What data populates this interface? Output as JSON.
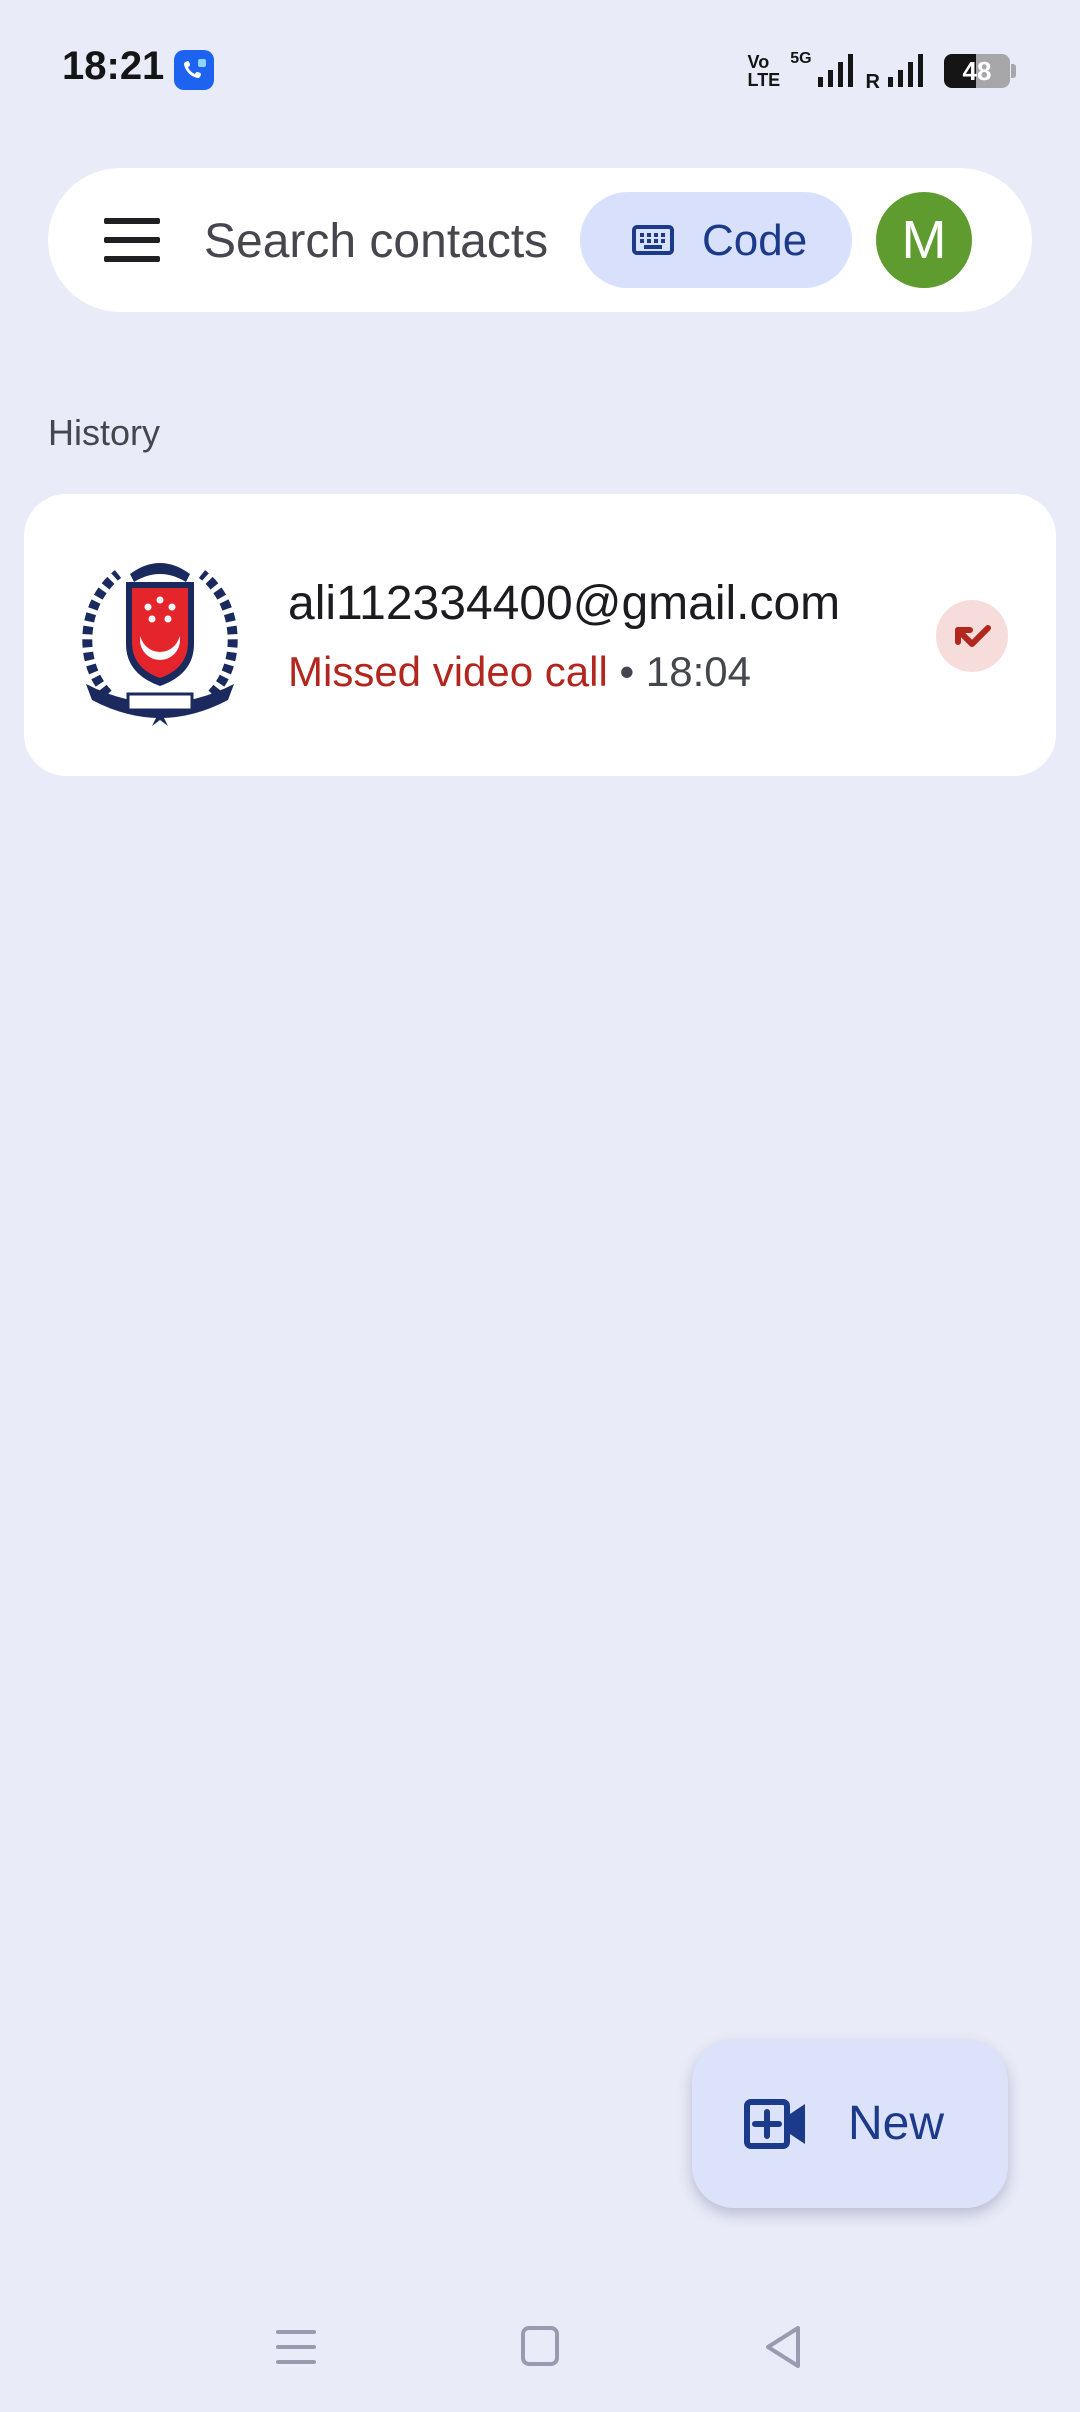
{
  "status_bar": {
    "time": "18:21",
    "app_icon": "phone-app-icon",
    "volte_line1": "Vo",
    "volte_line2": "LTE",
    "network": "5G",
    "roaming": "R",
    "battery_level": "48",
    "battery_percent": 48
  },
  "search": {
    "placeholder": "Search contacts",
    "menu_icon": "hamburger-menu-icon",
    "code_label": "Code",
    "code_icon": "keyboard-icon",
    "avatar_initial": "M",
    "avatar_color": "#5f9c2f"
  },
  "history": {
    "section_title": "History",
    "items": [
      {
        "contact": "ali112334400@gmail.com",
        "status": "Missed video call",
        "separator": " • ",
        "time": "18:04",
        "avatar_icon": "police-crest-logo",
        "status_color": "#b3261e",
        "action_icon": "missed-call-icon"
      }
    ]
  },
  "fab": {
    "label": "New",
    "icon": "add-video-call-icon"
  },
  "nav": {
    "recents": "recents-icon",
    "home": "home-icon",
    "back": "back-icon"
  },
  "colors": {
    "background": "#e9ebf8",
    "accent": "#1b3a8a",
    "chip": "#d9e0fb",
    "missed": "#b3261e"
  }
}
